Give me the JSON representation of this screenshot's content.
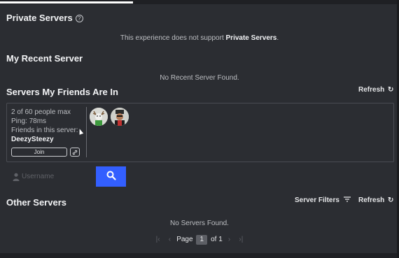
{
  "private_servers": {
    "title": "Private Servers",
    "help_icon": "?",
    "message_prefix": "This experience does not support ",
    "message_bold": "Private Servers",
    "message_suffix": "."
  },
  "recent_server": {
    "title": "My Recent Server",
    "empty_message": "No Recent Server Found."
  },
  "friends_servers": {
    "title": "Servers My Friends Are In",
    "refresh_label": "Refresh",
    "refresh_icon": "refresh-icon",
    "card": {
      "capacity": "2 of 60 people max",
      "ping": "Ping: 78ms",
      "friends_label": "Friends in this server:",
      "friend_name": "DeezySteezy",
      "join_label": "Join",
      "link_icon": "link-icon"
    }
  },
  "search": {
    "placeholder": "Username",
    "button_icon": "search-icon"
  },
  "other_servers": {
    "title": "Other Servers",
    "filters_label": "Server Filters",
    "refresh_label": "Refresh",
    "empty_message": "No Servers Found."
  },
  "pagination": {
    "page_label": "Page",
    "current_page": "1",
    "of_label": "of 1"
  },
  "colors": {
    "background": "#2b2d32",
    "accent": "#335fff",
    "text": "#e6e7e9"
  }
}
